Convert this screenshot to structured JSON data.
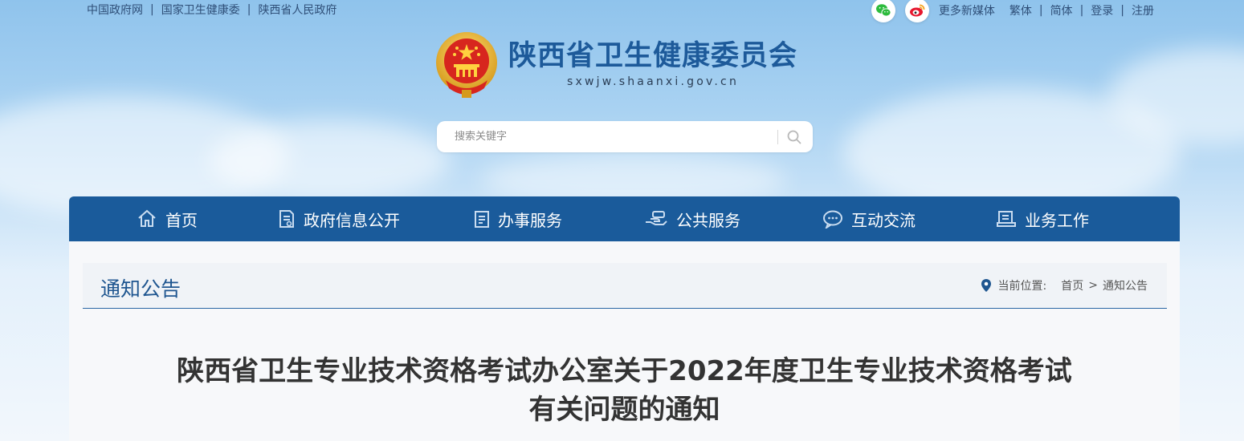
{
  "top_links": [
    "中国政府网",
    "国家卫生健康委",
    "陕西省人民政府"
  ],
  "top_right": {
    "media_label": "更多新媒体",
    "links": [
      "繁体",
      "简体",
      "登录",
      "注册"
    ]
  },
  "logo": {
    "title": "陕西省卫生健康委员会",
    "domain": "sxwjw.shaanxi.gov.cn"
  },
  "search": {
    "placeholder": "搜索关键字"
  },
  "nav": [
    {
      "label": "首页",
      "icon": "home-icon"
    },
    {
      "label": "政府信息公开",
      "icon": "document-icon"
    },
    {
      "label": "办事服务",
      "icon": "clipboard-icon"
    },
    {
      "label": "公共服务",
      "icon": "hand-service-icon"
    },
    {
      "label": "互动交流",
      "icon": "chat-icon"
    },
    {
      "label": "业务工作",
      "icon": "briefcase-icon"
    }
  ],
  "section": {
    "title": "通知公告",
    "location_label": "当前位置:",
    "breadcrumb": [
      "首页",
      "通知公告"
    ]
  },
  "article": {
    "title_line1": "陕西省卫生专业技术资格考试办公室关于2022年度卫生专业技术资格考试",
    "title_line2": "有关问题的通知"
  },
  "colors": {
    "nav_bg": "#1a5b9b",
    "brand_blue": "#1d5a9a",
    "wechat_green": "#2dbb3d",
    "weibo_red": "#e6162d"
  }
}
